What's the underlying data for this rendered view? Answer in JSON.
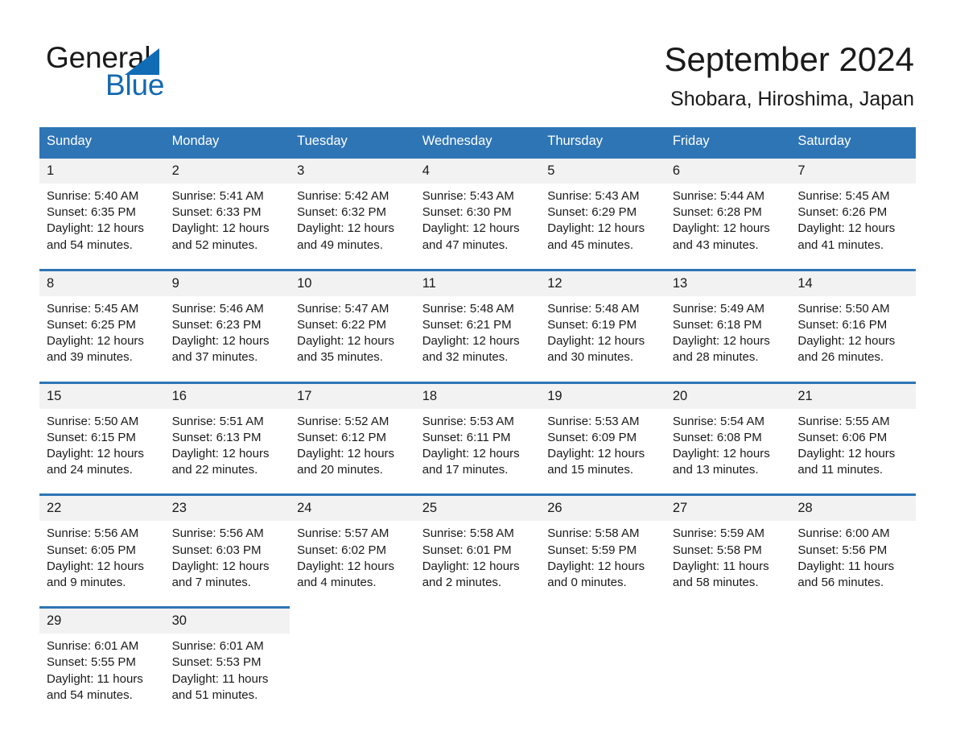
{
  "brand": {
    "name_part1": "General",
    "name_part2": "Blue",
    "triangle_color": "#0f6cb5",
    "blue_color": "#1569b0"
  },
  "header": {
    "title": "September 2024",
    "location": "Shobara, Hiroshima, Japan"
  },
  "theme": {
    "header_bg": "#2e75b6",
    "daynum_bg": "#f2f2f2",
    "text": "#1a1a1a",
    "page_bg": "#ffffff"
  },
  "calendar": {
    "weekday_headers": [
      "Sunday",
      "Monday",
      "Tuesday",
      "Wednesday",
      "Thursday",
      "Friday",
      "Saturday"
    ],
    "weeks": [
      [
        {
          "day": "1",
          "sunrise": "Sunrise: 5:40 AM",
          "sunset": "Sunset: 6:35 PM",
          "daylight_line1": "Daylight: 12 hours",
          "daylight_line2": "and 54 minutes."
        },
        {
          "day": "2",
          "sunrise": "Sunrise: 5:41 AM",
          "sunset": "Sunset: 6:33 PM",
          "daylight_line1": "Daylight: 12 hours",
          "daylight_line2": "and 52 minutes."
        },
        {
          "day": "3",
          "sunrise": "Sunrise: 5:42 AM",
          "sunset": "Sunset: 6:32 PM",
          "daylight_line1": "Daylight: 12 hours",
          "daylight_line2": "and 49 minutes."
        },
        {
          "day": "4",
          "sunrise": "Sunrise: 5:43 AM",
          "sunset": "Sunset: 6:30 PM",
          "daylight_line1": "Daylight: 12 hours",
          "daylight_line2": "and 47 minutes."
        },
        {
          "day": "5",
          "sunrise": "Sunrise: 5:43 AM",
          "sunset": "Sunset: 6:29 PM",
          "daylight_line1": "Daylight: 12 hours",
          "daylight_line2": "and 45 minutes."
        },
        {
          "day": "6",
          "sunrise": "Sunrise: 5:44 AM",
          "sunset": "Sunset: 6:28 PM",
          "daylight_line1": "Daylight: 12 hours",
          "daylight_line2": "and 43 minutes."
        },
        {
          "day": "7",
          "sunrise": "Sunrise: 5:45 AM",
          "sunset": "Sunset: 6:26 PM",
          "daylight_line1": "Daylight: 12 hours",
          "daylight_line2": "and 41 minutes."
        }
      ],
      [
        {
          "day": "8",
          "sunrise": "Sunrise: 5:45 AM",
          "sunset": "Sunset: 6:25 PM",
          "daylight_line1": "Daylight: 12 hours",
          "daylight_line2": "and 39 minutes."
        },
        {
          "day": "9",
          "sunrise": "Sunrise: 5:46 AM",
          "sunset": "Sunset: 6:23 PM",
          "daylight_line1": "Daylight: 12 hours",
          "daylight_line2": "and 37 minutes."
        },
        {
          "day": "10",
          "sunrise": "Sunrise: 5:47 AM",
          "sunset": "Sunset: 6:22 PM",
          "daylight_line1": "Daylight: 12 hours",
          "daylight_line2": "and 35 minutes."
        },
        {
          "day": "11",
          "sunrise": "Sunrise: 5:48 AM",
          "sunset": "Sunset: 6:21 PM",
          "daylight_line1": "Daylight: 12 hours",
          "daylight_line2": "and 32 minutes."
        },
        {
          "day": "12",
          "sunrise": "Sunrise: 5:48 AM",
          "sunset": "Sunset: 6:19 PM",
          "daylight_line1": "Daylight: 12 hours",
          "daylight_line2": "and 30 minutes."
        },
        {
          "day": "13",
          "sunrise": "Sunrise: 5:49 AM",
          "sunset": "Sunset: 6:18 PM",
          "daylight_line1": "Daylight: 12 hours",
          "daylight_line2": "and 28 minutes."
        },
        {
          "day": "14",
          "sunrise": "Sunrise: 5:50 AM",
          "sunset": "Sunset: 6:16 PM",
          "daylight_line1": "Daylight: 12 hours",
          "daylight_line2": "and 26 minutes."
        }
      ],
      [
        {
          "day": "15",
          "sunrise": "Sunrise: 5:50 AM",
          "sunset": "Sunset: 6:15 PM",
          "daylight_line1": "Daylight: 12 hours",
          "daylight_line2": "and 24 minutes."
        },
        {
          "day": "16",
          "sunrise": "Sunrise: 5:51 AM",
          "sunset": "Sunset: 6:13 PM",
          "daylight_line1": "Daylight: 12 hours",
          "daylight_line2": "and 22 minutes."
        },
        {
          "day": "17",
          "sunrise": "Sunrise: 5:52 AM",
          "sunset": "Sunset: 6:12 PM",
          "daylight_line1": "Daylight: 12 hours",
          "daylight_line2": "and 20 minutes."
        },
        {
          "day": "18",
          "sunrise": "Sunrise: 5:53 AM",
          "sunset": "Sunset: 6:11 PM",
          "daylight_line1": "Daylight: 12 hours",
          "daylight_line2": "and 17 minutes."
        },
        {
          "day": "19",
          "sunrise": "Sunrise: 5:53 AM",
          "sunset": "Sunset: 6:09 PM",
          "daylight_line1": "Daylight: 12 hours",
          "daylight_line2": "and 15 minutes."
        },
        {
          "day": "20",
          "sunrise": "Sunrise: 5:54 AM",
          "sunset": "Sunset: 6:08 PM",
          "daylight_line1": "Daylight: 12 hours",
          "daylight_line2": "and 13 minutes."
        },
        {
          "day": "21",
          "sunrise": "Sunrise: 5:55 AM",
          "sunset": "Sunset: 6:06 PM",
          "daylight_line1": "Daylight: 12 hours",
          "daylight_line2": "and 11 minutes."
        }
      ],
      [
        {
          "day": "22",
          "sunrise": "Sunrise: 5:56 AM",
          "sunset": "Sunset: 6:05 PM",
          "daylight_line1": "Daylight: 12 hours",
          "daylight_line2": "and 9 minutes."
        },
        {
          "day": "23",
          "sunrise": "Sunrise: 5:56 AM",
          "sunset": "Sunset: 6:03 PM",
          "daylight_line1": "Daylight: 12 hours",
          "daylight_line2": "and 7 minutes."
        },
        {
          "day": "24",
          "sunrise": "Sunrise: 5:57 AM",
          "sunset": "Sunset: 6:02 PM",
          "daylight_line1": "Daylight: 12 hours",
          "daylight_line2": "and 4 minutes."
        },
        {
          "day": "25",
          "sunrise": "Sunrise: 5:58 AM",
          "sunset": "Sunset: 6:01 PM",
          "daylight_line1": "Daylight: 12 hours",
          "daylight_line2": "and 2 minutes."
        },
        {
          "day": "26",
          "sunrise": "Sunrise: 5:58 AM",
          "sunset": "Sunset: 5:59 PM",
          "daylight_line1": "Daylight: 12 hours",
          "daylight_line2": "and 0 minutes."
        },
        {
          "day": "27",
          "sunrise": "Sunrise: 5:59 AM",
          "sunset": "Sunset: 5:58 PM",
          "daylight_line1": "Daylight: 11 hours",
          "daylight_line2": "and 58 minutes."
        },
        {
          "day": "28",
          "sunrise": "Sunrise: 6:00 AM",
          "sunset": "Sunset: 5:56 PM",
          "daylight_line1": "Daylight: 11 hours",
          "daylight_line2": "and 56 minutes."
        }
      ],
      [
        {
          "day": "29",
          "sunrise": "Sunrise: 6:01 AM",
          "sunset": "Sunset: 5:55 PM",
          "daylight_line1": "Daylight: 11 hours",
          "daylight_line2": "and 54 minutes."
        },
        {
          "day": "30",
          "sunrise": "Sunrise: 6:01 AM",
          "sunset": "Sunset: 5:53 PM",
          "daylight_line1": "Daylight: 11 hours",
          "daylight_line2": "and 51 minutes."
        },
        {
          "day": "",
          "sunrise": "",
          "sunset": "",
          "daylight_line1": "",
          "daylight_line2": ""
        },
        {
          "day": "",
          "sunrise": "",
          "sunset": "",
          "daylight_line1": "",
          "daylight_line2": ""
        },
        {
          "day": "",
          "sunrise": "",
          "sunset": "",
          "daylight_line1": "",
          "daylight_line2": ""
        },
        {
          "day": "",
          "sunrise": "",
          "sunset": "",
          "daylight_line1": "",
          "daylight_line2": ""
        },
        {
          "day": "",
          "sunrise": "",
          "sunset": "",
          "daylight_line1": "",
          "daylight_line2": ""
        }
      ]
    ]
  }
}
